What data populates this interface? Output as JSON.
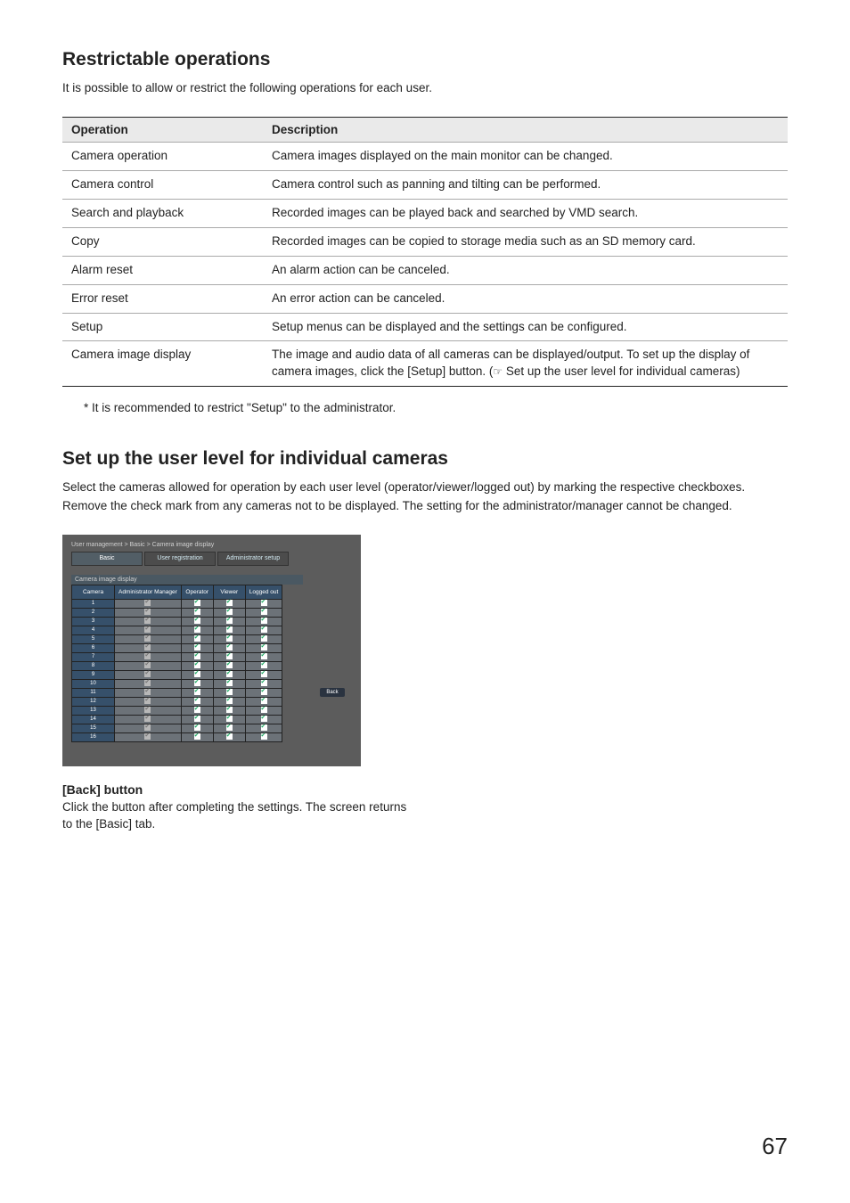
{
  "section1": {
    "title": "Restrictable operations",
    "intro": "It is possible to allow or restrict the following operations for each user.",
    "header_op": "Operation",
    "header_desc": "Description",
    "rows": [
      {
        "op": "Camera operation",
        "desc": "Camera images displayed on the main monitor can be changed."
      },
      {
        "op": "Camera control",
        "desc": "Camera control such as panning and tilting can be performed."
      },
      {
        "op": "Search and playback",
        "desc": "Recorded images can be played back and searched by VMD search."
      },
      {
        "op": "Copy",
        "desc": "Recorded images can be copied to storage media such as an SD memory card."
      },
      {
        "op": "Alarm reset",
        "desc": "An alarm action can be canceled."
      },
      {
        "op": "Error reset",
        "desc": "An error action can be canceled."
      },
      {
        "op": "Setup",
        "desc": "Setup menus can be displayed and the settings can be configured."
      },
      {
        "op": "Camera image display",
        "desc_a": "The image and audio data of all cameras can be displayed/output. To set up the display of camera images, click the [Setup] button. (",
        "desc_b": " Set up the user level for individual cameras)"
      }
    ],
    "footnote": "* It is recommended to restrict \"Setup\" to the administrator."
  },
  "section2": {
    "title": "Set up the user level for individual cameras",
    "intro": "Select the cameras allowed for operation by each user level (operator/viewer/logged out) by marking the respective checkboxes. Remove the check mark from any cameras not to be displayed. The setting for the administrator/manager cannot be changed."
  },
  "screenshot": {
    "crumb": "User management  >  Basic  >  Camera image display",
    "tabs": {
      "basic": "Basic",
      "user_reg": "User registration",
      "admin_setup": "Administrator setup"
    },
    "panel_label": "Camera image display",
    "cols": {
      "camera": "Camera",
      "admin": "Administrator Manager",
      "operator": "Operator",
      "viewer": "Viewer",
      "loggedout": "Logged out"
    },
    "camera_count": 16,
    "back_btn": "Back"
  },
  "back": {
    "title": "[Back] button",
    "desc": "Click the button after completing the settings. The screen returns to the [Basic] tab."
  },
  "pageno": "67",
  "ref_icon": "☞"
}
